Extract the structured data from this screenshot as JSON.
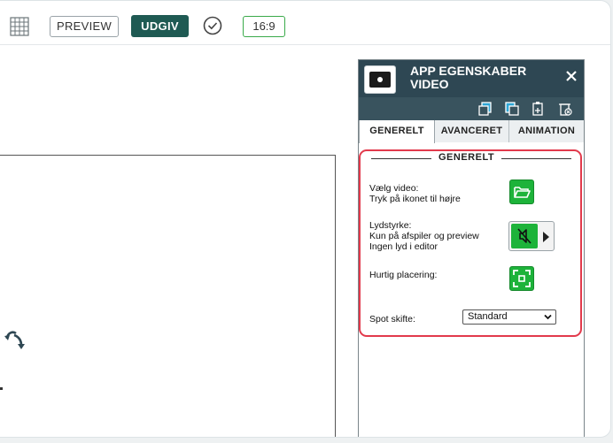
{
  "toolbar": {
    "preview_label": "PREVIEW",
    "publish_label": "UDGIV",
    "aspect_ratio": "16:9",
    "icons": {
      "grid": "grid-icon",
      "status": "check-circle-icon"
    },
    "colors": {
      "publish_bg": "#1f5a53",
      "ratio_border": "#3aaa4a"
    }
  },
  "panel": {
    "title_line1": "APP EGENSKABER",
    "title_line2": "VIDEO",
    "icons": [
      "video-icon",
      "close-icon",
      "copy-icon",
      "duplicate-icon",
      "paste-icon",
      "delete-icon"
    ],
    "tabs": [
      {
        "label": "GENERELT",
        "active": true
      },
      {
        "label": "AVANCERET",
        "active": false
      },
      {
        "label": "ANIMATION",
        "active": false
      }
    ],
    "section": {
      "title": "GENERELT",
      "video_label_1": "Vælg video:",
      "video_label_2": "Tryk på ikonet til højre",
      "volume_label_1": "Lydstyrke:",
      "volume_label_2": "Kun på afspiler og preview",
      "volume_label_3": "Ingen lyd i editor",
      "placement_label": "Hurtig placering:",
      "spot_label": "Spot skifte:",
      "spot_value": "Standard"
    },
    "colors": {
      "header": "#2e4753",
      "action_green": "#1db33a",
      "highlight": "#e23a4c"
    }
  }
}
